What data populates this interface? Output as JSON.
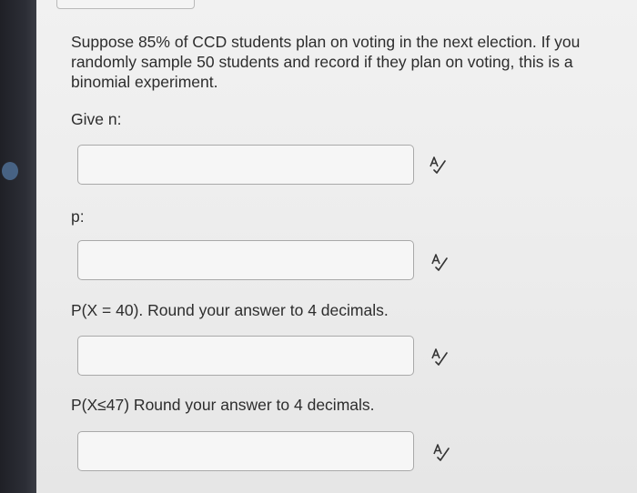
{
  "question": {
    "text": "Suppose 85% of CCD students plan on voting in the next election.  If you randomly sample 50 students and record if they plan on voting, this is a binomial experiment."
  },
  "fields": [
    {
      "label": "Give n:",
      "value": ""
    },
    {
      "label": "p:",
      "value": ""
    },
    {
      "label": "P(X = 40). Round your answer to 4 decimals.",
      "value": ""
    },
    {
      "label": "P(X≤47) Round your answer to 4 decimals.",
      "value": ""
    }
  ],
  "icons": {
    "spellcheck": "spellcheck-icon"
  }
}
